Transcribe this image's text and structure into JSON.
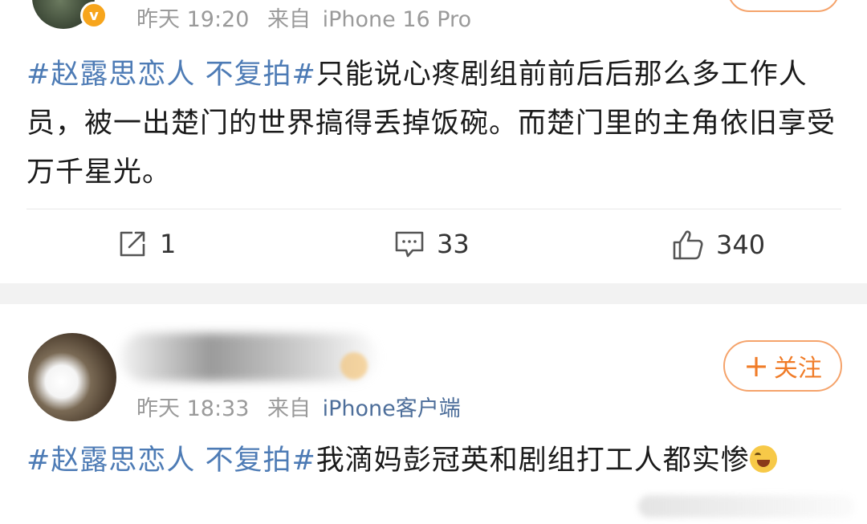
{
  "post1": {
    "time": "昨天 19:20",
    "source_prefix": "来自",
    "device": "iPhone 16 Pro",
    "hashtag": "#赵露思恋人 不复拍#",
    "text": "只能说心疼剧组前前后后那么多工作人员，被一出楚门的世界搞得丢掉饭碗。而楚门里的主角依旧享受万千星光。",
    "actions": {
      "repost_count": "1",
      "comment_count": "33",
      "like_count": "340"
    }
  },
  "post2": {
    "time": "昨天 18:33",
    "source_prefix": "来自",
    "device": "iPhone客户端",
    "follow_label": "关注",
    "follow_plus": "+",
    "hashtag": "#赵露思恋人 不复拍#",
    "text": "我滴妈彭冠英和剧组打工人都实惨"
  },
  "icons": {
    "repost": "repost-icon",
    "comment": "comment-icon",
    "like": "thumbs-up-icon",
    "verified": "verified-badge-icon",
    "emoji": "laughing-tears-emoji"
  },
  "colors": {
    "hashtag": "#4d7bb5",
    "follow": "#f07c28",
    "badge": "#f7a51c"
  }
}
